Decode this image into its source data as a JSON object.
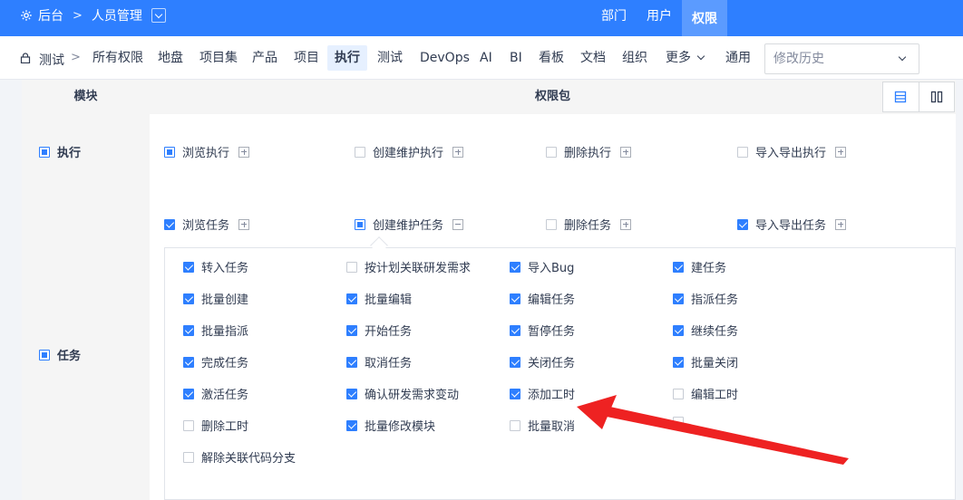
{
  "topbar": {
    "home": "后台",
    "section": "人员管理",
    "nav": [
      "部门",
      "用户",
      "权限"
    ],
    "active_nav": "权限",
    "bg_color": "#2e7fff"
  },
  "tabs": {
    "current": "测试",
    "items": [
      "所有权限",
      "地盘",
      "项目集",
      "产品",
      "项目",
      "执行",
      "测试",
      "DevOps",
      "AI",
      "BI",
      "看板",
      "文档",
      "组织",
      "更多",
      "通用"
    ],
    "active": "执行",
    "history_placeholder": "修改历史"
  },
  "table": {
    "col_module": "模块",
    "col_packages": "权限包",
    "modules": [
      {
        "name": "执行",
        "state": "partial"
      },
      {
        "name": "任务",
        "state": "partial"
      }
    ],
    "execution_packages": [
      {
        "label": "浏览执行",
        "state": "partial",
        "toggle": "+"
      },
      {
        "label": "创建维护执行",
        "state": "unchecked",
        "toggle": "+"
      },
      {
        "label": "删除执行",
        "state": "unchecked",
        "toggle": "+"
      },
      {
        "label": "导入导出执行",
        "state": "unchecked",
        "toggle": "+"
      }
    ],
    "task_packages": [
      {
        "label": "浏览任务",
        "state": "checked",
        "toggle": "+"
      },
      {
        "label": "创建维护任务",
        "state": "partial",
        "toggle": "−"
      },
      {
        "label": "删除任务",
        "state": "unchecked",
        "toggle": "+"
      },
      {
        "label": "导入导出任务",
        "state": "checked",
        "toggle": "+"
      }
    ],
    "privileges": [
      {
        "label": "转入任务",
        "checked": true
      },
      {
        "label": "按计划关联研发需求",
        "checked": false
      },
      {
        "label": "导入Bug",
        "checked": true
      },
      {
        "label": "建任务",
        "checked": true
      },
      {
        "label": "批量创建",
        "checked": true
      },
      {
        "label": "批量编辑",
        "checked": true
      },
      {
        "label": "编辑任务",
        "checked": true
      },
      {
        "label": "指派任务",
        "checked": true
      },
      {
        "label": "批量指派",
        "checked": true
      },
      {
        "label": "开始任务",
        "checked": true
      },
      {
        "label": "暂停任务",
        "checked": true
      },
      {
        "label": "继续任务",
        "checked": true
      },
      {
        "label": "完成任务",
        "checked": true
      },
      {
        "label": "取消任务",
        "checked": true
      },
      {
        "label": "关闭任务",
        "checked": true
      },
      {
        "label": "批量关闭",
        "checked": true
      },
      {
        "label": "激活任务",
        "checked": true
      },
      {
        "label": "确认研发需求变动",
        "checked": true
      },
      {
        "label": "添加工时",
        "checked": true
      },
      {
        "label": "编辑工时",
        "checked": false
      },
      {
        "label": "删除工时",
        "checked": false
      },
      {
        "label": "批量修改模块",
        "checked": true
      },
      {
        "label": "批量取消",
        "checked": false
      },
      {
        "label": "",
        "checked": false
      },
      {
        "label": "解除关联代码分支",
        "checked": false
      }
    ]
  },
  "annotation": {
    "arrow_color": "#ee2222"
  }
}
